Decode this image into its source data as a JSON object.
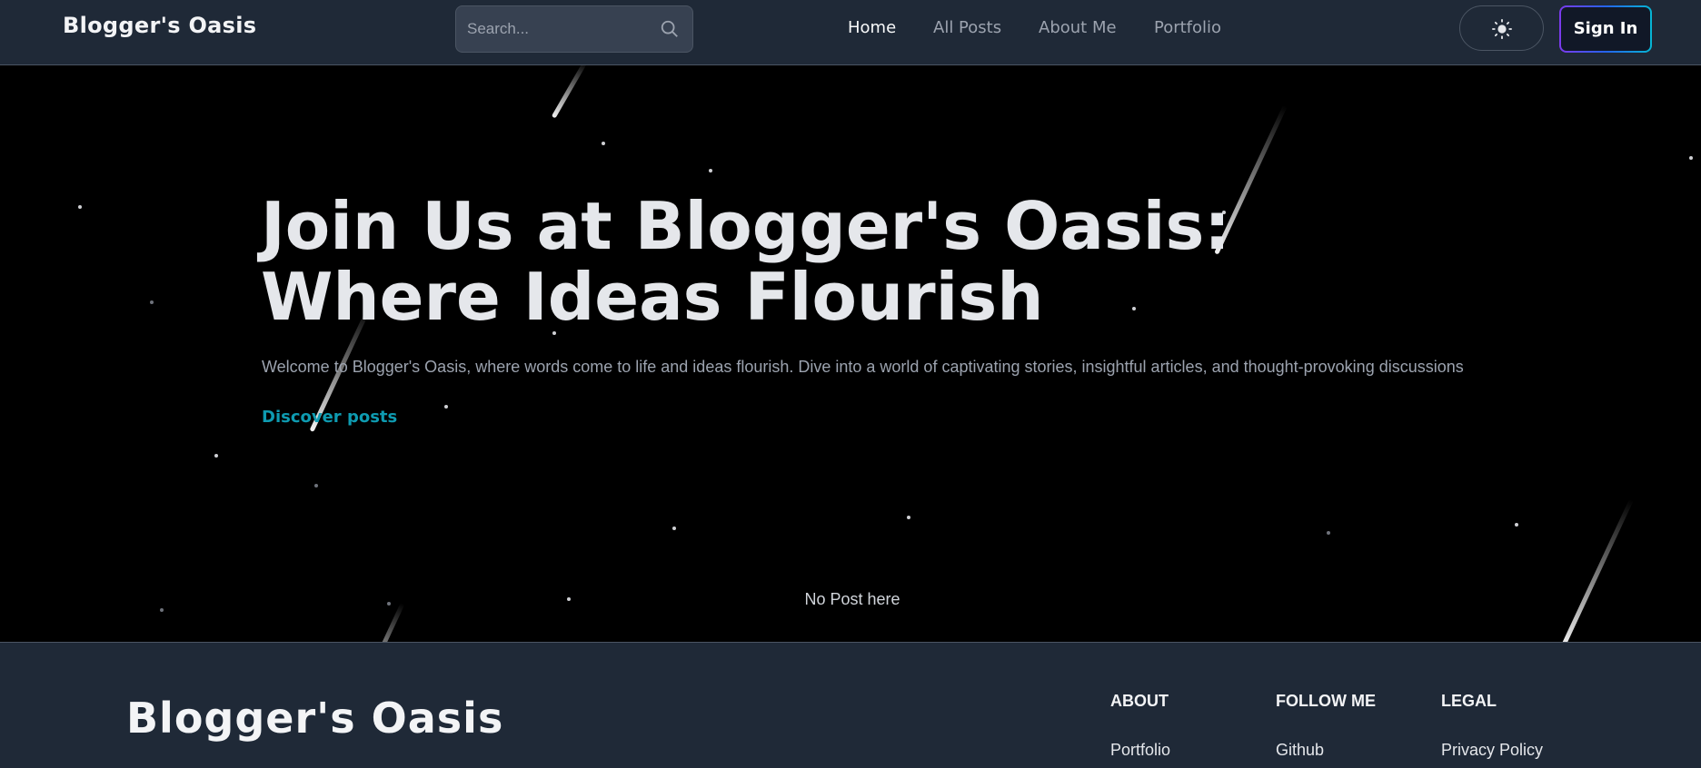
{
  "header": {
    "brand": "Blogger's Oasis",
    "search": {
      "placeholder": "Search..."
    },
    "nav": [
      {
        "label": "Home",
        "active": true
      },
      {
        "label": "All Posts",
        "active": false
      },
      {
        "label": "About Me",
        "active": false
      },
      {
        "label": "Portfolio",
        "active": false
      }
    ],
    "theme_toggle_icon": "sun-icon",
    "sign_in_label": "Sign In"
  },
  "hero": {
    "title_line1": "Join Us at Blogger's Oasis:",
    "title_line2": "Where Ideas Flourish",
    "subtitle": "Welcome to Blogger's Oasis, where words come to life and ideas flourish. Dive into a world of captivating stories, insightful articles, and thought-provoking discussions",
    "cta": "Discover posts",
    "empty_message": "No Post here"
  },
  "footer": {
    "brand": "Blogger's Oasis",
    "columns": [
      {
        "heading": "ABOUT",
        "link": "Portfolio"
      },
      {
        "heading": "FOLLOW ME",
        "link": "Github"
      },
      {
        "heading": "LEGAL",
        "link": "Privacy Policy"
      }
    ]
  },
  "colors": {
    "nav_bg": "#1f2937",
    "hero_bg": "#000000",
    "accent": "#0e9bb1"
  }
}
